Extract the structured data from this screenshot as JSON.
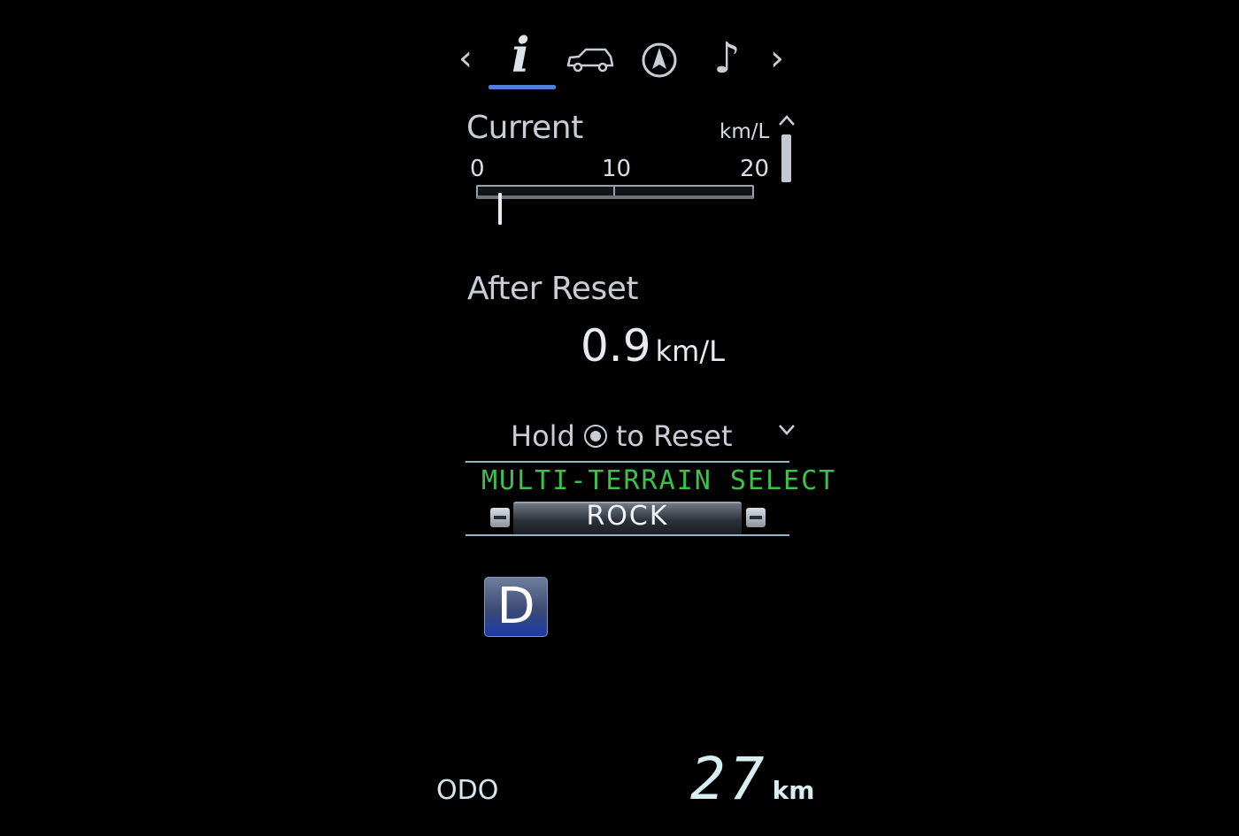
{
  "nav": {
    "prev_icon": "chevron-left-icon",
    "next_icon": "chevron-right-icon",
    "tabs": [
      {
        "icon": "info-icon",
        "glyph": "i",
        "active": true
      },
      {
        "icon": "vehicle-icon",
        "active": false
      },
      {
        "icon": "navigation-compass-icon",
        "active": false
      },
      {
        "icon": "music-note-icon",
        "glyph": "♪",
        "active": false
      }
    ],
    "active_color": "#4f7fd6"
  },
  "current": {
    "label": "Current",
    "unit": "km/L",
    "scale_ticks": [
      "0",
      "10",
      "20"
    ],
    "scale_min": 0,
    "scale_max": 20,
    "value": 0.9
  },
  "after_reset": {
    "label": "After Reset",
    "value": "0.9",
    "unit": "km/L"
  },
  "reset_hint": {
    "before": "Hold",
    "after": "to Reset",
    "button_icon": "ok-button-icon"
  },
  "terrain": {
    "title": "MULTI-TERRAIN SELECT",
    "mode": "ROCK",
    "title_color": "#3cc24a"
  },
  "gear": {
    "position": "D"
  },
  "odometer": {
    "label": "ODO",
    "value": "27",
    "unit": "km"
  },
  "scroll": {
    "up_icon": "scroll-up-icon",
    "down_icon": "scroll-down-icon"
  }
}
